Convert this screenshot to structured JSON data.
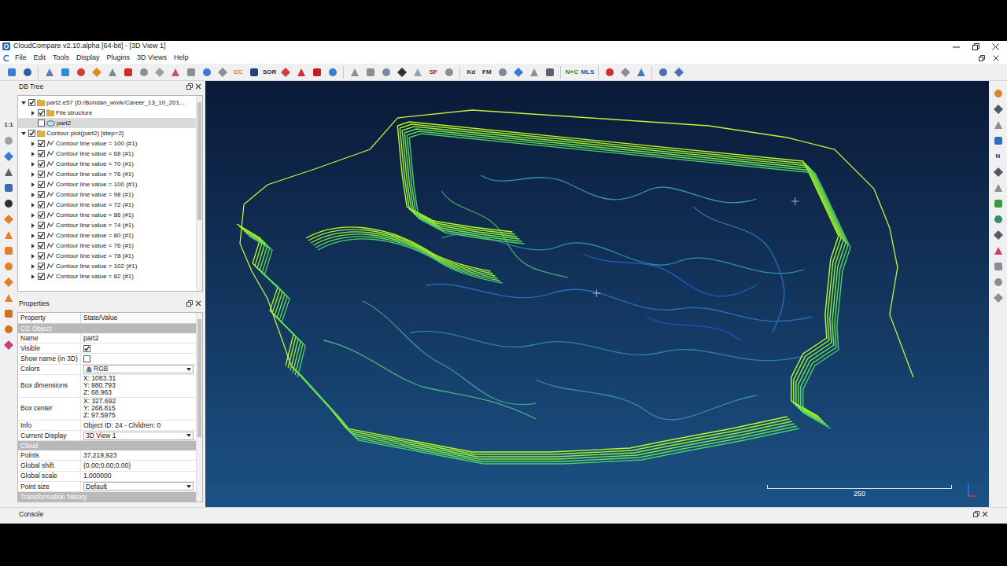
{
  "window": {
    "title": "CloudCompare v2.10.alpha [64-bit] - [3D View 1]"
  },
  "menu": [
    "File",
    "Edit",
    "Tools",
    "Display",
    "Plugins",
    "3D Views",
    "Help"
  ],
  "toolbar": [
    {
      "kind": "icon",
      "color": "#3b7dd8"
    },
    {
      "kind": "icon",
      "color": "#2a5fa8"
    },
    {
      "kind": "separator"
    },
    {
      "kind": "icon",
      "color": "#5a7fb0"
    },
    {
      "kind": "icon",
      "color": "#2e8bd8"
    },
    {
      "kind": "icon",
      "color": "#d83a3a"
    },
    {
      "kind": "icon",
      "color": "#e08a20"
    },
    {
      "kind": "icon",
      "color": "#7a8a9a"
    },
    {
      "kind": "icon",
      "color": "#d02a2a"
    },
    {
      "kind": "icon",
      "color": "#8a8f96"
    },
    {
      "kind": "icon",
      "color": "#9aa0a8"
    },
    {
      "kind": "icon",
      "color": "#d04a8a"
    },
    {
      "kind": "icon",
      "color": "#8a8f96"
    },
    {
      "kind": "icon",
      "color": "#3a7ad0"
    },
    {
      "kind": "icon",
      "color": "#8a8f96"
    },
    {
      "kind": "text",
      "label": "CC",
      "color": "#e07020"
    },
    {
      "kind": "icon",
      "color": "#20407a"
    },
    {
      "kind": "text",
      "label": "SOR",
      "color": "#303030"
    },
    {
      "kind": "icon",
      "color": "#d04040"
    },
    {
      "kind": "icon",
      "color": "#d03030"
    },
    {
      "kind": "icon",
      "color": "#c02020"
    },
    {
      "kind": "icon",
      "color": "#3a7ad0"
    },
    {
      "kind": "separator"
    },
    {
      "kind": "icon",
      "color": "#8a8f96"
    },
    {
      "kind": "icon",
      "color": "#8a8f96"
    },
    {
      "kind": "icon",
      "color": "#7a8a9a"
    },
    {
      "kind": "icon",
      "color": "#303030"
    },
    {
      "kind": "icon",
      "color": "#9aa0a8"
    },
    {
      "kind": "text",
      "label": "SF",
      "color": "#a02020"
    },
    {
      "kind": "icon",
      "color": "#8a8f96"
    },
    {
      "kind": "separator"
    },
    {
      "kind": "text",
      "label": "Kd",
      "color": "#303030"
    },
    {
      "kind": "text",
      "label": "FM",
      "color": "#303030"
    },
    {
      "kind": "icon",
      "color": "#7a8a9a"
    },
    {
      "kind": "icon",
      "color": "#3a7ad0"
    },
    {
      "kind": "icon",
      "color": "#8a8f96"
    },
    {
      "kind": "icon",
      "color": "#5a6470"
    },
    {
      "kind": "separator"
    },
    {
      "kind": "text",
      "label": "N+C",
      "color": "#208020"
    },
    {
      "kind": "text",
      "label": "MLS",
      "color": "#3050a0"
    },
    {
      "kind": "separator"
    },
    {
      "kind": "icon",
      "color": "#d03030"
    },
    {
      "kind": "icon",
      "color": "#8a8f96"
    },
    {
      "kind": "icon",
      "color": "#3a7ad0"
    },
    {
      "kind": "separator"
    },
    {
      "kind": "icon",
      "color": "#4a70b0"
    },
    {
      "kind": "icon",
      "color": "#4a70b0"
    }
  ],
  "left_toolbar": [
    {
      "kind": "text",
      "label": "1:1",
      "color": "#303030"
    },
    {
      "kind": "icon",
      "color": "#9aa0a8"
    },
    {
      "kind": "icon",
      "color": "#3a7ad0"
    },
    {
      "kind": "icon",
      "color": "#5a6470"
    },
    {
      "kind": "icon",
      "color": "#3a6ab0"
    },
    {
      "kind": "icon",
      "color": "#303030"
    },
    {
      "kind": "icon",
      "color": "#e0802a"
    },
    {
      "kind": "icon",
      "color": "#e0802a"
    },
    {
      "kind": "icon",
      "color": "#e0802a"
    },
    {
      "kind": "icon",
      "color": "#e0802a"
    },
    {
      "kind": "icon",
      "color": "#e0802a"
    },
    {
      "kind": "icon",
      "color": "#e0802a"
    },
    {
      "kind": "icon",
      "color": "#d07020"
    },
    {
      "kind": "icon",
      "color": "#d07020"
    },
    {
      "kind": "icon",
      "color": "#c04080"
    }
  ],
  "right_toolbar": [
    {
      "kind": "icon",
      "color": "#d08a30"
    },
    {
      "kind": "icon",
      "color": "#505a66"
    },
    {
      "kind": "icon",
      "color": "#8a8f96"
    },
    {
      "kind": "icon",
      "color": "#2a6fc0"
    },
    {
      "kind": "text",
      "label": "N",
      "color": "#303030"
    },
    {
      "kind": "icon",
      "color": "#505a66"
    },
    {
      "kind": "icon",
      "color": "#8a8f96"
    },
    {
      "kind": "icon",
      "color": "#3a9a3a"
    },
    {
      "kind": "icon",
      "color": "#3a8a6a"
    },
    {
      "kind": "icon",
      "color": "#505a66"
    },
    {
      "kind": "icon",
      "color": "#d04060"
    },
    {
      "kind": "icon",
      "color": "#8a8f96"
    },
    {
      "kind": "icon",
      "color": "#8a8f96"
    },
    {
      "kind": "icon",
      "color": "#8a8f96"
    }
  ],
  "db_tree": {
    "title": "DB Tree",
    "items": [
      {
        "label": "part2.e57 (D:/Bohdan_work/Career_13_10_201...",
        "kind": "folder",
        "depth": 0,
        "expandable": true,
        "expanded": true,
        "checked": true,
        "selected": false
      },
      {
        "label": "File structure",
        "kind": "folder",
        "depth": 1,
        "expandable": true,
        "expanded": false,
        "checked": true,
        "selected": false
      },
      {
        "label": "part2",
        "kind": "cloud",
        "depth": 1,
        "expandable": false,
        "expanded": false,
        "checked": false,
        "selected": true
      },
      {
        "label": "Contour plot(part2) [step=2]",
        "kind": "folder",
        "depth": 0,
        "expandable": true,
        "expanded": true,
        "checked": true,
        "selected": false
      },
      {
        "label": "Contour line value = 100 (#1)",
        "kind": "polyline",
        "depth": 1,
        "expandable": true,
        "expanded": false,
        "checked": true,
        "selected": false
      },
      {
        "label": "Contour line value = 68 (#1)",
        "kind": "polyline",
        "depth": 1,
        "expandable": true,
        "expanded": false,
        "checked": true,
        "selected": false
      },
      {
        "label": "Contour line value = 70 (#1)",
        "kind": "polyline",
        "depth": 1,
        "expandable": true,
        "expanded": false,
        "checked": true,
        "selected": false
      },
      {
        "label": "Contour line value = 76 (#1)",
        "kind": "polyline",
        "depth": 1,
        "expandable": true,
        "expanded": false,
        "checked": true,
        "selected": false
      },
      {
        "label": "Contour line value = 100 (#1)",
        "kind": "polyline",
        "depth": 1,
        "expandable": true,
        "expanded": false,
        "checked": true,
        "selected": false
      },
      {
        "label": "Contour line value = 98 (#1)",
        "kind": "polyline",
        "depth": 1,
        "expandable": true,
        "expanded": false,
        "checked": true,
        "selected": false
      },
      {
        "label": "Contour line value = 72 (#1)",
        "kind": "polyline",
        "depth": 1,
        "expandable": true,
        "expanded": false,
        "checked": true,
        "selected": false
      },
      {
        "label": "Contour line value = 86 (#1)",
        "kind": "polyline",
        "depth": 1,
        "expandable": true,
        "expanded": false,
        "checked": true,
        "selected": false
      },
      {
        "label": "Contour line value = 74 (#1)",
        "kind": "polyline",
        "depth": 1,
        "expandable": true,
        "expanded": false,
        "checked": true,
        "selected": false
      },
      {
        "label": "Contour line value = 80 (#1)",
        "kind": "polyline",
        "depth": 1,
        "expandable": true,
        "expanded": false,
        "checked": true,
        "selected": false
      },
      {
        "label": "Contour line value = 76 (#1)",
        "kind": "polyline",
        "depth": 1,
        "expandable": true,
        "expanded": false,
        "checked": true,
        "selected": false
      },
      {
        "label": "Contour line value = 78 (#1)",
        "kind": "polyline",
        "depth": 1,
        "expandable": true,
        "expanded": false,
        "checked": true,
        "selected": false
      },
      {
        "label": "Contour line value = 102 (#1)",
        "kind": "polyline",
        "depth": 1,
        "expandable": true,
        "expanded": false,
        "checked": true,
        "selected": false
      },
      {
        "label": "Contour line value = 82 (#1)",
        "kind": "polyline",
        "depth": 1,
        "expandable": true,
        "expanded": false,
        "checked": true,
        "selected": false
      }
    ]
  },
  "properties": {
    "title": "Properties",
    "columns": [
      "Property",
      "State/Value"
    ],
    "rows": [
      {
        "kind": "section",
        "label": "CC Object"
      },
      {
        "kind": "text",
        "label": "Name",
        "value": "part2"
      },
      {
        "kind": "check",
        "label": "Visible",
        "checked": true
      },
      {
        "kind": "check",
        "label": "Show name (in 3D)",
        "checked": false
      },
      {
        "kind": "combo",
        "label": "Colors",
        "value": "RGB"
      },
      {
        "kind": "multi",
        "label": "Box dimensions",
        "lines": [
          "X: 1083.31",
          "Y: 980.793",
          "Z: 68.963"
        ]
      },
      {
        "kind": "multi",
        "label": "Box center",
        "lines": [
          "X: 327.692",
          "Y: 268.815",
          "Z: 97.5975"
        ]
      },
      {
        "kind": "text",
        "label": "Info",
        "value": "Object ID: 24 - Children: 0"
      },
      {
        "kind": "combo",
        "label": "Current Display",
        "value": "3D View 1"
      },
      {
        "kind": "section",
        "label": "Cloud"
      },
      {
        "kind": "text",
        "label": "Points",
        "value": "37,219,923"
      },
      {
        "kind": "text",
        "label": "Global shift",
        "value": "(0.00;0.00;0.00)"
      },
      {
        "kind": "text",
        "label": "Global scale",
        "value": "1.000000"
      },
      {
        "kind": "combo",
        "label": "Point size",
        "value": "Default"
      },
      {
        "kind": "section",
        "label": "Transformation history"
      }
    ]
  },
  "view": {
    "scale_label": "250"
  },
  "console": {
    "title": "Console"
  }
}
